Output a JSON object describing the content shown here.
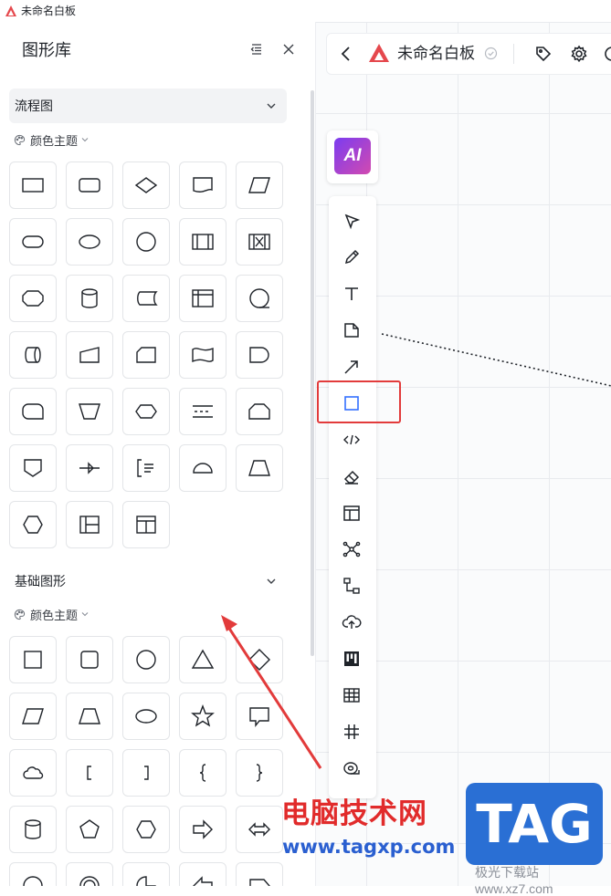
{
  "window": {
    "title": "未命名白板"
  },
  "panel": {
    "title": "图形库",
    "sections": {
      "flow": {
        "title": "流程图",
        "theme_label": "颜色主题",
        "expanded": true
      },
      "basic": {
        "title": "基础图形",
        "theme_label": "颜色主题",
        "expanded": true
      }
    }
  },
  "board": {
    "title": "未命名白板"
  },
  "ai": {
    "label": "AI"
  },
  "watermark": {
    "site_cn": "电脑技术网",
    "url": "www.tagxp.com",
    "tag": "TAG",
    "sub": "极光下载站 www.xz7.com"
  },
  "colors": {
    "accent": "#3370ff",
    "highlight": "#e23b3b",
    "ai_start": "#7b3cf0",
    "ai_end": "#d24ab0"
  }
}
